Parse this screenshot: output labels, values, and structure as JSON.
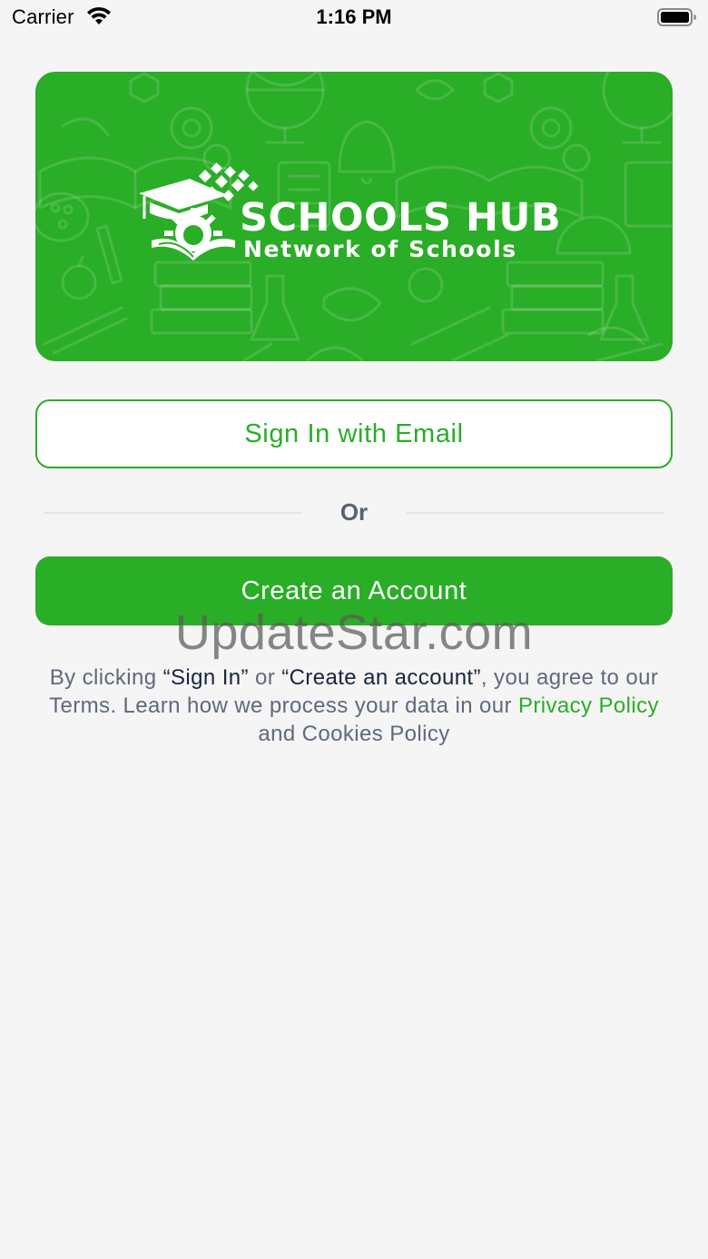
{
  "status_bar": {
    "carrier": "Carrier",
    "time": "1:16 PM",
    "wifi_icon": "wifi-icon",
    "battery_icon": "battery-full-icon"
  },
  "banner": {
    "title": "SCHOOLS HUB",
    "subtitle": "Network of Schools",
    "background_color": "#2aad27",
    "logo_icon": "graduation-cap-gear-book-logo"
  },
  "auth": {
    "sign_in_label": "Sign In with Email",
    "divider_label": "Or",
    "create_account_label": "Create an Account"
  },
  "watermark": "UpdateStar.com",
  "terms": {
    "part1": "By clicking ",
    "sign_in_quote": "“Sign In”",
    "part2": " or ",
    "create_quote": "“Create an account”",
    "part3": ", you agree to our Terms. Learn how we process your data in our ",
    "privacy_link": "Privacy Policy",
    "part4": " and Cookies Policy"
  },
  "colors": {
    "accent": "#2aad27",
    "background": "#f5f5f5",
    "text_muted": "#5e6a7c",
    "text_dark": "#17263c"
  }
}
